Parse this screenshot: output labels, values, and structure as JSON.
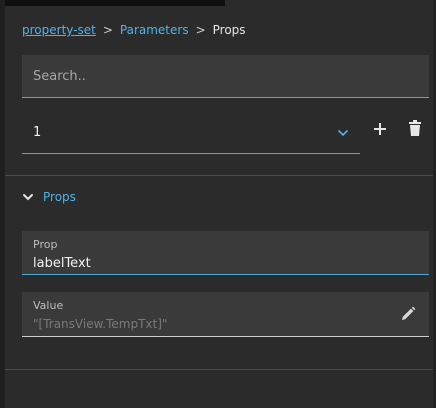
{
  "breadcrumb": {
    "items": [
      "property-set",
      "Parameters",
      "Props"
    ],
    "separator": ">"
  },
  "search": {
    "placeholder": "Search.."
  },
  "selector": {
    "value": "1"
  },
  "section": {
    "title": "Props",
    "expanded": true
  },
  "prop_field": {
    "label": "Prop",
    "value": "labelText"
  },
  "value_field": {
    "label": "Value",
    "placeholder": "\"[TransView.TempTxt]\""
  },
  "icons": {
    "dropdown": "chevron-down-icon",
    "add": "plus-icon",
    "delete": "trash-icon",
    "section": "chevron-down-icon",
    "edit": "pencil-icon"
  },
  "colors": {
    "accent": "#4fb4e8",
    "background": "#2b2b2b",
    "field": "#3a3a3a"
  }
}
